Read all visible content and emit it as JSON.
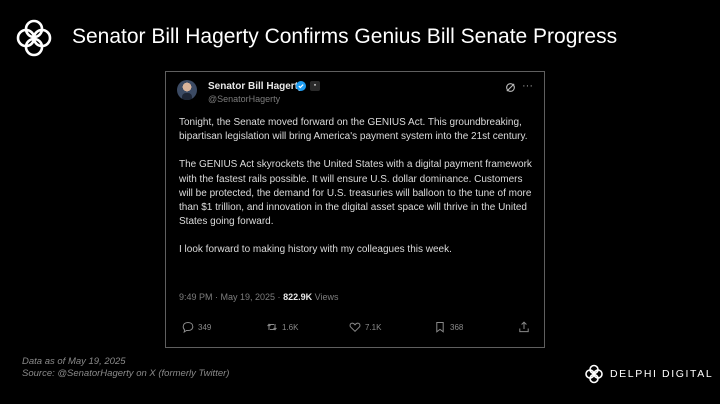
{
  "slide": {
    "title": "Senator Bill Hagerty Confirms Genius Bill Senate Progress",
    "logo_icon": "delphi-knot-logo-icon"
  },
  "tweet": {
    "author_name": "Senator Bill Hagerty",
    "handle": "@SenatorHagerty",
    "paragraphs": [
      "Tonight, the Senate moved forward on the GENIUS Act. This groundbreaking, bipartisan legislation will bring America's payment system into the 21st century.",
      "The GENIUS Act skyrockets the United States with a digital payment framework with the fastest rails possible. It will ensure U.S. dollar dominance. Customers will be protected, the demand for U.S. treasuries will balloon to the tune of more than $1 trillion, and innovation in the digital asset space will thrive in the United States going forward.",
      "I look forward to making history with my colleagues this week."
    ],
    "timestamp": "9:49 PM · May 19, 2025 ·",
    "views_count": "822.9K",
    "views_label": "Views",
    "actions": {
      "replies": "349",
      "reposts": "1.6K",
      "likes": "7.1K",
      "bookmarks": "368"
    },
    "colors": {
      "verified": "#1d9bf0",
      "border": "#5f5f5f"
    }
  },
  "footnote": {
    "line1": "Data as of May 19, 2025",
    "line2": "Source: @SenatorHagerty  on X (formerly Twitter)"
  },
  "brand": {
    "name": "DELPHI DIGITAL"
  }
}
